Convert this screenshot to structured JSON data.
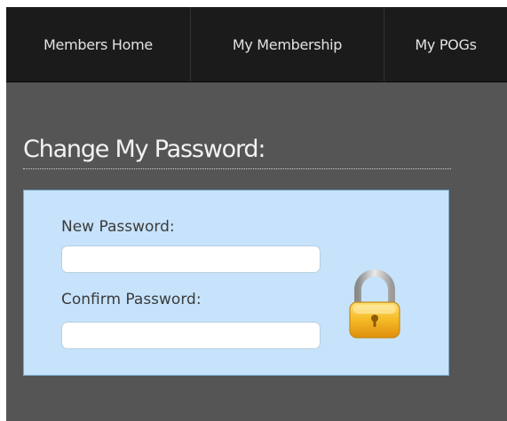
{
  "nav": {
    "items": [
      "Members Home",
      "My Membership",
      "My POGs"
    ]
  },
  "main": {
    "title": "Change My Password:",
    "fields": [
      {
        "label": "New Password:",
        "value": ""
      },
      {
        "label": "Confirm Password:",
        "value": ""
      }
    ],
    "icon": "padlock-icon"
  },
  "colors": {
    "nav_bg": "#1b1b1b",
    "page_bg": "#555555",
    "panel_bg": "#c6e3fb",
    "lock_gold": "#f2b51e"
  }
}
